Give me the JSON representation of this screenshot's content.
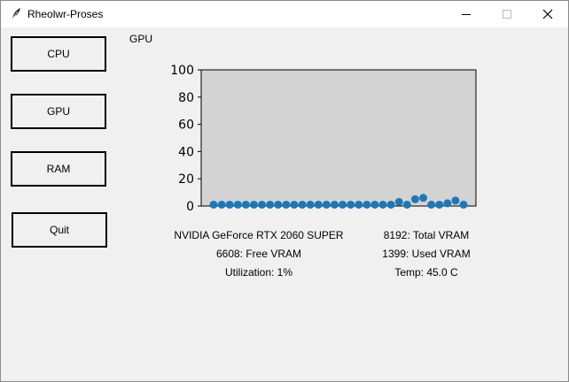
{
  "window": {
    "title": "Rheolwr-Proses",
    "icon": "feather-icon"
  },
  "sidebar": {
    "cpu_label": "CPU",
    "gpu_label": "GPU",
    "ram_label": "RAM",
    "quit_label": "Quit"
  },
  "view_label": "GPU",
  "chart_data": {
    "type": "scatter",
    "title": "",
    "xlabel": "",
    "ylabel": "",
    "ylim": [
      0,
      100
    ],
    "yticks": [
      "0",
      "20",
      "40",
      "60",
      "80",
      "100"
    ],
    "grid": false,
    "colors": {
      "plot_background": "#d3d3d3",
      "marker": "#1f77b4"
    },
    "series": [
      {
        "x": [
          1,
          2,
          3,
          4,
          5,
          6,
          7,
          8,
          9,
          10,
          11,
          12,
          13,
          14,
          15,
          16,
          17,
          18,
          19,
          20,
          21,
          22,
          23,
          24,
          25,
          26,
          27,
          28,
          29,
          30,
          31,
          32
        ],
        "values": [
          1,
          1,
          1,
          1,
          1,
          1,
          1,
          1,
          1,
          1,
          1,
          1,
          1,
          1,
          1,
          1,
          1,
          1,
          1,
          1,
          1,
          1,
          1,
          3,
          1,
          5,
          6,
          1,
          1,
          2,
          4,
          1
        ]
      }
    ]
  },
  "gpu_info": {
    "name": "NVIDIA GeForce RTX 2060 SUPER",
    "free_vram": "6608: Free VRAM",
    "utilization": "Utilization: 1%",
    "total_vram": "8192: Total VRAM",
    "used_vram": "1399: Used VRAM",
    "temp": "Temp: 45.0 C"
  }
}
